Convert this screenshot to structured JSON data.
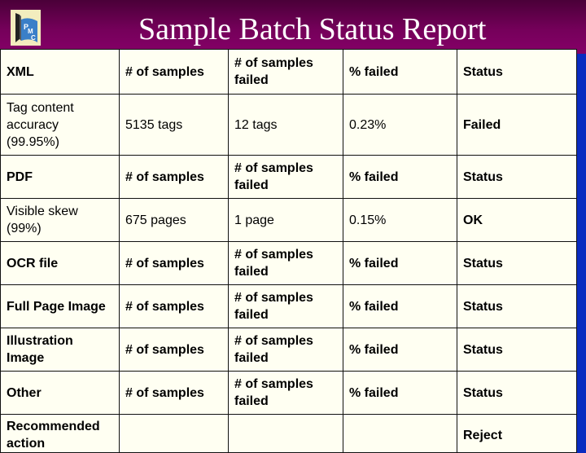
{
  "header": {
    "title": "Sample Batch Status Report",
    "logo_text": "PMC"
  },
  "colors": {
    "header_bg": "#75005a",
    "side_bg": "#0a2bc0",
    "table_bg": "#fffff2",
    "failed": "#d4141a",
    "ok": "#167a16"
  },
  "table": {
    "rows": [
      {
        "type": "header",
        "cells": [
          "XML",
          "# of samples",
          "# of samples failed",
          "% failed",
          "Status"
        ]
      },
      {
        "type": "data",
        "cells": [
          "Tag content accuracy (99.95%)",
          "5135 tags",
          "12 tags",
          "0.23%",
          "Failed"
        ],
        "status": "failed"
      },
      {
        "type": "header",
        "cells": [
          "PDF",
          "# of samples",
          "# of samples failed",
          "% failed",
          "Status"
        ]
      },
      {
        "type": "data",
        "cells": [
          "Visible skew (99%)",
          "675 pages",
          "1 page",
          "0.15%",
          "OK"
        ],
        "status": "ok"
      },
      {
        "type": "header",
        "cells": [
          "OCR file",
          "# of samples",
          "# of samples failed",
          "% failed",
          "Status"
        ]
      },
      {
        "type": "header",
        "cells": [
          "Full Page Image",
          "# of samples",
          "# of samples failed",
          "% failed",
          "Status"
        ]
      },
      {
        "type": "header",
        "cells": [
          "Illustration Image",
          "# of samples",
          "# of samples failed",
          "% failed",
          "Status"
        ]
      },
      {
        "type": "header",
        "cells": [
          "Other",
          "# of samples",
          "# of samples failed",
          "% failed",
          "Status"
        ]
      },
      {
        "type": "action",
        "cells": [
          "Recommended action",
          "",
          "",
          "",
          "Reject"
        ]
      }
    ]
  }
}
